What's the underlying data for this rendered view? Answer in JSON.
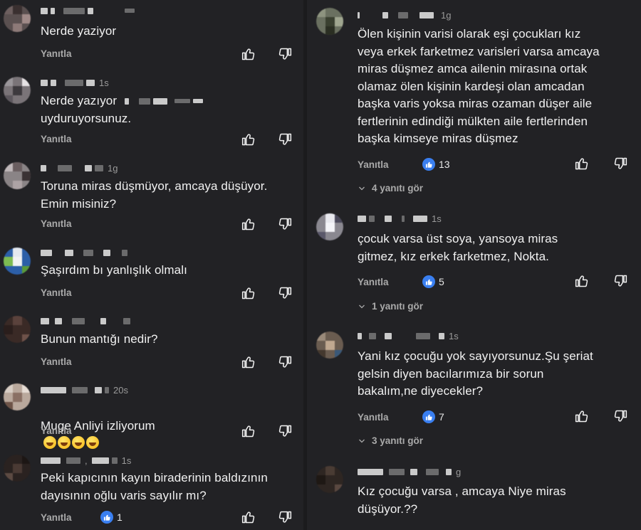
{
  "left_comments": [
    {
      "text": "Nerde yaziyor",
      "reply_label": "Yanıtla",
      "likes": "",
      "ts": ""
    },
    {
      "text": "Nerde yazıyor\nuyduruyorsunuz.",
      "reply_label": "Yanıtla",
      "likes": "",
      "ts": "1s"
    },
    {
      "text": "Toruna miras düşmüyor, amcaya düşüyor.\nEmin misiniz?",
      "reply_label": "Yanıtla",
      "likes": "",
      "ts": "1g"
    },
    {
      "text": "Şaşırdım bı yanlışlık olmalı",
      "reply_label": "Yanıtla",
      "likes": "",
      "ts": ""
    },
    {
      "text": "Bunun mantığı nedir?",
      "reply_label": "Yanıtla",
      "likes": "",
      "ts": ""
    },
    {
      "text": "Muge Anliyi izliyorum",
      "reply_label": "Yanıtla",
      "likes": "",
      "ts": "20s"
    },
    {
      "text": "Peki kapıcının kayın biraderinin baldızının\ndayısının oğlu varis sayılır mı?",
      "reply_label": "Yanıtla",
      "likes": "1",
      "ts": "1s"
    }
  ],
  "right_comments": [
    {
      "text": "Ölen kişinin varisi olarak eşi çocukları kız\nveya erkek farketmez varisleri varsa amcaya\nmiras düşmez amca ailenin mirasına ortak\nolamaz ölen kişinin kardeşi olan amcadan\nbaşka varis yoksa miras ozaman düşer aile\nfertlerinin edindiği mülkten aile fertlerinden\nbaşka kimseye miras düşmez",
      "reply_label": "Yanıtla",
      "likes": "13",
      "replies": "4 yanıtı gör",
      "ts": "1g"
    },
    {
      "text": "çocuk varsa üst soya, yansoya miras\ngitmez, kız erkek farketmez, Nokta.",
      "reply_label": "Yanıtla",
      "likes": "5",
      "replies": "1 yanıtı gör",
      "ts": "1s"
    },
    {
      "text": "Yani kız çocuğu yok sayıyorsunuz.Şu şeriat\ngelsin diyen bacılarımıza bir sorun\nbakalım,ne diyecekler?",
      "reply_label": "Yanıtla",
      "likes": "7",
      "replies": "3 yanıtı gör",
      "ts": "1s"
    },
    {
      "text": "Kız çocuğu varsa , amcaya Niye miras\ndüşüyor.??",
      "reply_label": "",
      "likes": "",
      "replies": "",
      "ts": "g"
    }
  ],
  "icons": {
    "like": "thumb-up-icon",
    "dislike": "thumb-down-icon",
    "chevron": "chevron-down-icon"
  },
  "colors": {
    "background": "#222225",
    "like_badge": "#3a7ff0",
    "text": "#f1f1f1",
    "muted": "#aaaaaa"
  }
}
